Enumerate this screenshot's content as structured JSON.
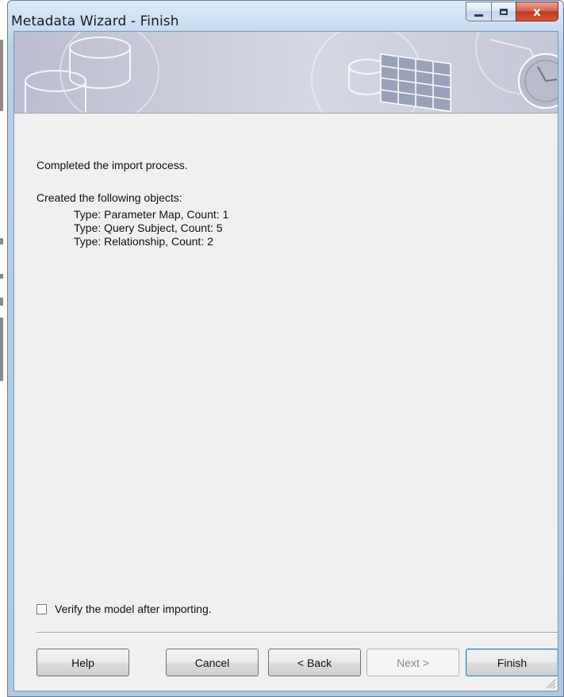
{
  "window": {
    "title": "Metadata Wizard - Finish",
    "controls": {
      "minimize_icon": "minimize-icon",
      "maximize_icon": "maximize-icon",
      "close_icon": "close-icon",
      "close_glyph": "x"
    }
  },
  "banner": {
    "icon": "database-spreadsheet-banner"
  },
  "content": {
    "status": "Completed the import process.",
    "created_heading": "Created the following objects:",
    "objects": [
      "Type: Parameter Map, Count: 1",
      "Type: Query Subject, Count: 5",
      "Type: Relationship, Count: 2"
    ]
  },
  "options": {
    "verify_label": "Verify the model after importing.",
    "verify_checked": false
  },
  "buttons": {
    "help": "Help",
    "cancel": "Cancel",
    "back": "< Back",
    "next": "Next >",
    "finish": "Finish"
  },
  "colors": {
    "title_bar": "#c5daf1",
    "client_bg": "#f0f0f0",
    "close_button": "#c0391e"
  }
}
